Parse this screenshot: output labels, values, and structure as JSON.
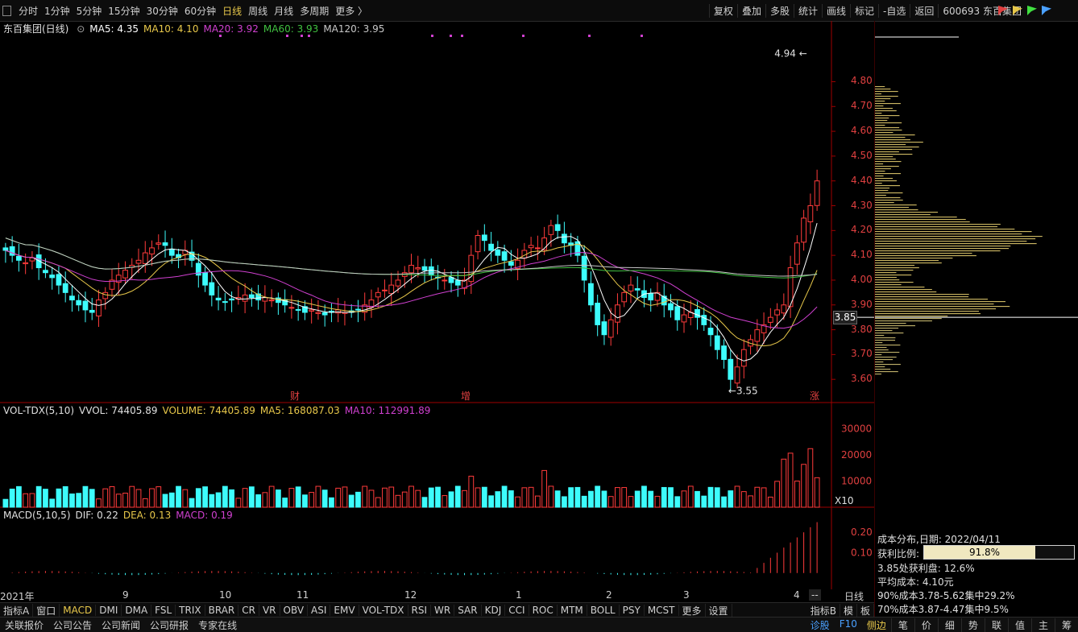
{
  "toolbar": {
    "periods": [
      "分时",
      "1分钟",
      "5分钟",
      "15分钟",
      "30分钟",
      "60分钟",
      "日线",
      "周线",
      "月线",
      "多周期",
      "更多 〉"
    ],
    "active_period": "日线",
    "tools": [
      "复权",
      "叠加",
      "多股",
      "统计",
      "画线",
      "标记",
      "-自选",
      "返回"
    ],
    "stock_code": "600693 东百集团"
  },
  "main": {
    "title": "东百集团(日线)",
    "ma_legend": [
      {
        "label": "MA5: 4.35",
        "color": "#ffffff"
      },
      {
        "label": "MA10: 4.10",
        "color": "#e8c84a"
      },
      {
        "label": "MA20: 3.92",
        "color": "#d040d0"
      },
      {
        "label": "MA60: 3.93",
        "color": "#40c040"
      },
      {
        "label": "MA120: 3.95",
        "color": "#c8c8c8"
      }
    ],
    "y_ticks": [
      "4.80",
      "4.70",
      "4.60",
      "4.50",
      "4.40",
      "4.30",
      "4.20",
      "4.10",
      "4.00",
      "3.90",
      "3.80",
      "3.70",
      "3.60"
    ],
    "price_tag": "3.85",
    "high_label": "4.94",
    "low_label": "3.55",
    "markers": [
      {
        "text": "财"
      },
      {
        "text": "增"
      },
      {
        "text": "涨"
      }
    ]
  },
  "volume": {
    "legend": [
      "VOL-TDX(5,10)",
      "VVOL: 74405.89",
      "VOLUME: 74405.89",
      "MA5: 168087.03",
      "MA10: 112991.89"
    ],
    "y_ticks": [
      "30000",
      "20000",
      "10000"
    ],
    "unit": "X10"
  },
  "macd": {
    "legend": [
      "MACD(5,10,5)",
      "DIF: 0.22",
      "DEA: 0.13",
      "MACD: 0.19"
    ],
    "y_ticks": [
      "0.20",
      "0.10"
    ]
  },
  "xaxis": {
    "labels": [
      "2021年",
      "9",
      "10",
      "11",
      "12",
      "1",
      "2",
      "3",
      "4"
    ],
    "right_btn": "--",
    "right_label": "日线"
  },
  "indicators": {
    "items": [
      "指标A",
      "窗口",
      "MACD",
      "DMI",
      "DMA",
      "FSL",
      "TRIX",
      "BRAR",
      "CR",
      "VR",
      "OBV",
      "ASI",
      "EMV",
      "VOL-TDX",
      "RSI",
      "WR",
      "SAR",
      "KDJ",
      "CCI",
      "ROC",
      "MTM",
      "BOLL",
      "PSY",
      "MCST",
      "更多",
      "设置"
    ],
    "active": "MACD",
    "right_items": [
      "指标B",
      "模",
      "板"
    ]
  },
  "statusbar": {
    "left": [
      "关联报价",
      "公司公告",
      "公司新闻",
      "公司研报",
      "专家在线"
    ],
    "mid": [
      "诊股",
      "F10",
      "侧边"
    ],
    "right_tabs": [
      "笔",
      "价",
      "细",
      "势",
      "联",
      "值",
      "主",
      "筹"
    ]
  },
  "cost_panel": {
    "date_line": "成本分布,日期:  2022/04/11",
    "profit_label": "获利比例:",
    "profit_value": "91.8%",
    "profit_fraction": 0.918,
    "line2": "3.85处获利盘:  12.6%",
    "line3": "平均成本:  4.10元",
    "line4": "90%成本3.78-5.62集中29.2%",
    "line5": "70%成本3.87-4.47集中9.5%"
  },
  "chart_data": {
    "type": "candlestick",
    "series_close": [
      4.12,
      4.1,
      4.08,
      4.07,
      4.09,
      4.05,
      4.03,
      4.01,
      3.98,
      3.95,
      3.92,
      3.9,
      3.88,
      3.87,
      3.92,
      3.95,
      4.0,
      4.02,
      4.04,
      4.06,
      4.08,
      4.11,
      4.13,
      4.15,
      4.14,
      4.1,
      4.09,
      4.12,
      4.08,
      4.02,
      3.98,
      3.94,
      3.92,
      3.91,
      3.92,
      3.93,
      3.94,
      3.93,
      3.92,
      3.93,
      3.92,
      3.91,
      3.9,
      3.89,
      3.88,
      3.87,
      3.88,
      3.87,
      3.86,
      3.87,
      3.88,
      3.87,
      3.87,
      3.88,
      3.9,
      3.92,
      3.95,
      3.96,
      3.98,
      4.0,
      4.03,
      4.06,
      4.05,
      4.04,
      4.02,
      4.01,
      4.0,
      3.99,
      3.98,
      4.0,
      4.1,
      4.18,
      4.16,
      4.12,
      4.1,
      4.08,
      4.06,
      4.08,
      4.12,
      4.14,
      4.13,
      4.17,
      4.22,
      4.2,
      4.15,
      4.14,
      4.1,
      4.0,
      3.9,
      3.82,
      3.78,
      3.84,
      3.9,
      3.95,
      3.98,
      3.96,
      3.93,
      3.92,
      3.95,
      3.9,
      3.88,
      3.84,
      3.86,
      3.87,
      3.85,
      3.82,
      3.78,
      3.72,
      3.68,
      3.6,
      3.65,
      3.72,
      3.76,
      3.8,
      3.82,
      3.85,
      3.88,
      3.9,
      4.05,
      4.15,
      4.25,
      4.3,
      4.4
    ],
    "ylim": [
      3.5,
      4.98
    ],
    "volume_ylim": [
      0,
      35000
    ],
    "macd_ylim": [
      -0.08,
      0.26
    ]
  },
  "colors": {
    "up": "#ff3b3b",
    "down": "#3dfcfc",
    "axis": "#a00000",
    "ma5": "#ffffff",
    "ma10": "#e8c84a",
    "ma20": "#d040d0",
    "ma60": "#40c040",
    "ma120": "#c8c8c8"
  }
}
